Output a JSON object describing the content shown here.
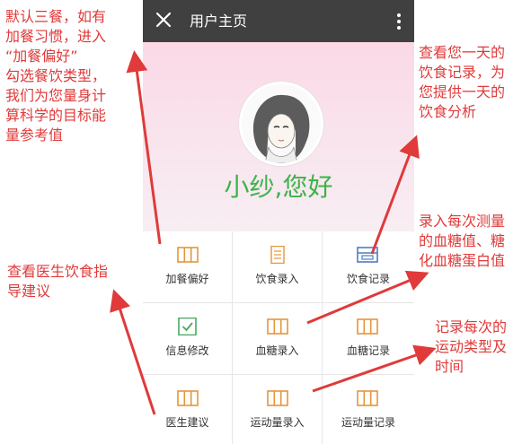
{
  "topbar": {
    "title": "用户主页"
  },
  "greeting": "小纱,您好",
  "menu": [
    {
      "label": "加餐偏好",
      "icon": "columns-icon"
    },
    {
      "label": "饮食录入",
      "icon": "document-icon"
    },
    {
      "label": "饮食记录",
      "icon": "record-icon"
    },
    {
      "label": "信息修改",
      "icon": "checkbox-icon"
    },
    {
      "label": "血糖录入",
      "icon": "columns-icon"
    },
    {
      "label": "血糖记录",
      "icon": "columns-icon"
    },
    {
      "label": "医生建议",
      "icon": "columns-icon"
    },
    {
      "label": "运动量录入",
      "icon": "columns-icon"
    },
    {
      "label": "运动量记录",
      "icon": "columns-icon"
    }
  ],
  "annotations": {
    "snack": [
      "默认三餐，如有",
      "加餐习惯，进入",
      "“加餐偏好”",
      "勾选餐饮类型，",
      "我们为您量身计",
      "算科学的目标能",
      "量参考值"
    ],
    "diet_record": [
      "查看您一天的",
      "饮食记录，为",
      "您提供一天的",
      "饮食分析"
    ],
    "glucose": [
      "录入每次测量",
      "的血糖值、糖",
      "化血糖蛋白值"
    ],
    "doctor": [
      "查看医生饮食指",
      "导建议"
    ],
    "exercise": [
      "记录每次的",
      "运动类型及",
      "时间"
    ]
  },
  "colors": {
    "annotation": "#e03a3a",
    "icon_orange": "#e8943a",
    "icon_blue": "#4a7fc1",
    "icon_green": "#4aa860",
    "greeting": "#3cb34a"
  }
}
